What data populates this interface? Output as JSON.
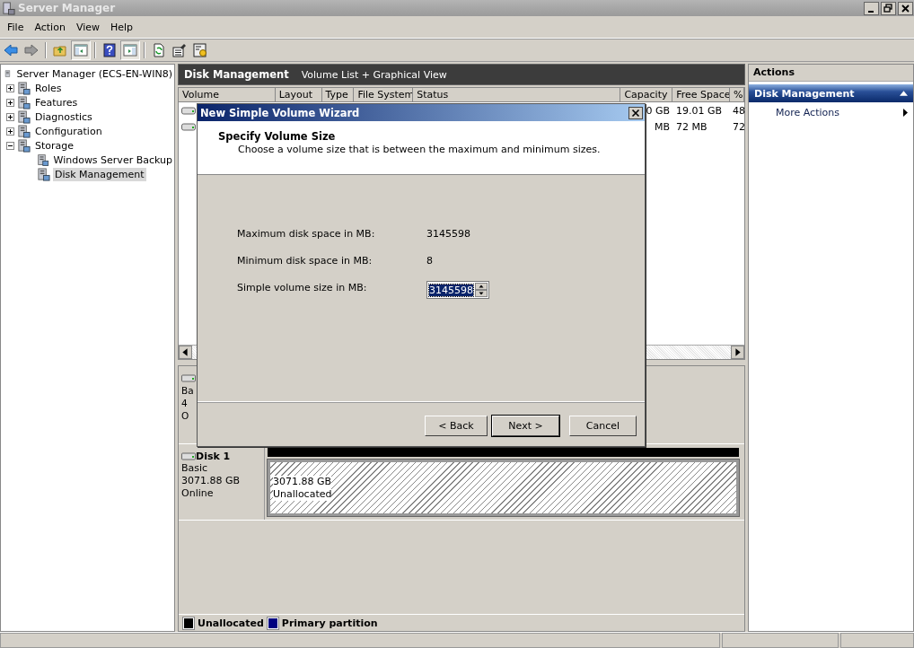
{
  "window": {
    "title": "Server Manager"
  },
  "menu": [
    "File",
    "Action",
    "View",
    "Help"
  ],
  "toolbar": [
    [
      {
        "kind": "back",
        "pressed": false
      },
      {
        "kind": "forward",
        "pressed": false
      }
    ],
    [
      {
        "kind": "up",
        "pressed": false
      },
      {
        "kind": "tree-pane",
        "pressed": true
      }
    ],
    [
      {
        "kind": "help",
        "pressed": false
      },
      {
        "kind": "action-pane",
        "pressed": true
      }
    ],
    [
      {
        "kind": "refresh",
        "pressed": false
      },
      {
        "kind": "properties",
        "pressed": false
      },
      {
        "kind": "settings",
        "pressed": false
      }
    ]
  ],
  "tree": {
    "label": "Server Manager (ECS-EN-WIN8)",
    "selected": false,
    "children": [
      {
        "label": "Roles",
        "expanded": false,
        "selected": false
      },
      {
        "label": "Features",
        "expanded": false,
        "selected": false
      },
      {
        "label": "Diagnostics",
        "expanded": false,
        "selected": false
      },
      {
        "label": "Configuration",
        "expanded": false,
        "selected": false
      },
      {
        "label": "Storage",
        "expanded": true,
        "selected": false,
        "children": [
          {
            "label": "Windows Server Backup",
            "selected": false
          },
          {
            "label": "Disk Management",
            "selected": true
          }
        ]
      }
    ]
  },
  "center": {
    "title": "Disk Management",
    "subtitle": "Volume List + Graphical View",
    "columns": [
      "Volume",
      "Layout",
      "Type",
      "File System",
      "Status",
      "Capacity",
      "Free Space",
      "%"
    ],
    "rows": [
      {
        "capacity": "0 GB",
        "free_space": "19.01 GB",
        "percent": "48"
      },
      {
        "capacity": "MB",
        "free_space": "72 MB",
        "percent": "72"
      }
    ],
    "disks": [
      {
        "lines": [
          "Ba",
          "4",
          "O"
        ]
      },
      {
        "name": "Disk 1",
        "lines": [
          "Basic",
          "3071.88 GB",
          "Online"
        ],
        "partition": {
          "size": "3071.88 GB",
          "label": "Unallocated"
        }
      }
    ],
    "legend": [
      {
        "label": "Unallocated",
        "color": "#000000"
      },
      {
        "label": "Primary partition",
        "color": "#000080"
      }
    ]
  },
  "actions": {
    "title": "Actions",
    "section": "Disk Management",
    "expanded": true,
    "items": [
      "More Actions"
    ]
  },
  "dialog": {
    "title": "New Simple Volume Wizard",
    "heading": "Specify Volume Size",
    "subheading": "Choose a volume size that is between the maximum and minimum sizes.",
    "fields": [
      {
        "kind": "text",
        "label": "Maximum disk space in MB:",
        "value": "3145598"
      },
      {
        "kind": "text",
        "label": "Minimum disk space in MB:",
        "value": "8"
      },
      {
        "kind": "spinner",
        "label": "Simple volume size in MB:",
        "value": "3145598",
        "text_selected": true
      }
    ],
    "buttons": [
      {
        "label": "< Back",
        "default": false
      },
      {
        "label": "Next >",
        "default": true
      },
      {
        "label": "Cancel",
        "default": false
      }
    ]
  }
}
